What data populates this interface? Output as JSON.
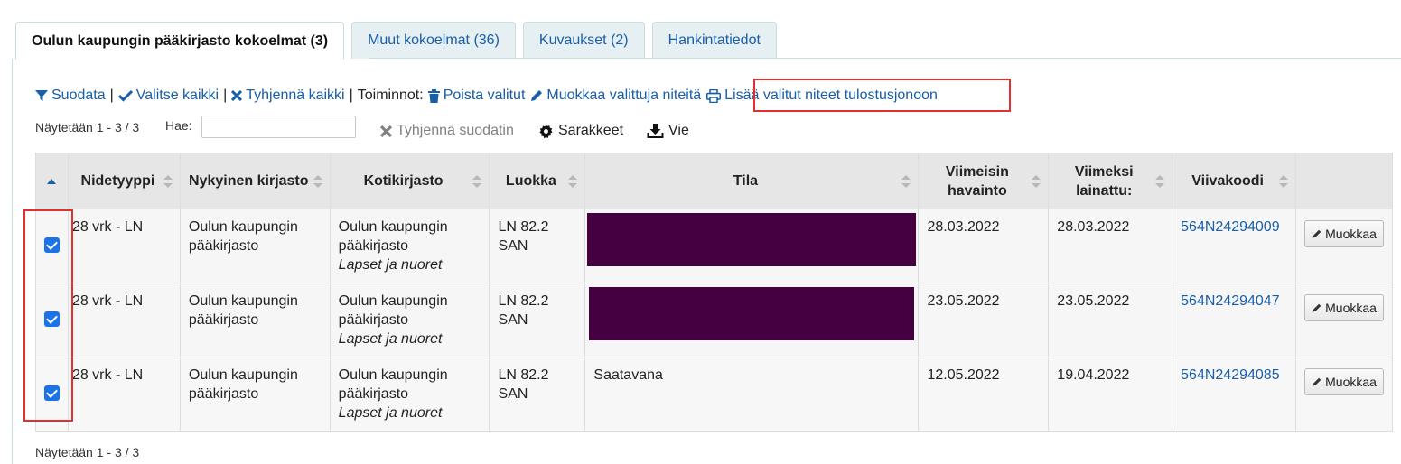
{
  "tabs": [
    {
      "label": "Oulun kaupungin pääkirjasto kokoelmat (3)",
      "active": true
    },
    {
      "label": "Muut kokoelmat (36)"
    },
    {
      "label": "Kuvaukset (2)"
    },
    {
      "label": "Hankintatiedot"
    }
  ],
  "toolbar": {
    "filter": "Suodata",
    "select_all": "Valitse kaikki",
    "clear_all": "Tyhjennä kaikki",
    "separator": "|",
    "actions_label": "Toiminnot:",
    "delete_selected": "Poista valitut",
    "edit_selected": "Muokkaa valittuja niteitä",
    "add_to_print_queue": "Lisää valitut niteet tulostusjonoon"
  },
  "info": {
    "showing": "Näytetään 1 - 3 / 3",
    "search_label": "Hae:",
    "search_value": "",
    "clear_filter": "Tyhjennä suodatin",
    "columns": "Sarakkeet",
    "export": "Vie"
  },
  "table": {
    "headers": {
      "item_type": "Nidetyyppi",
      "current_library": "Nykyinen kirjasto",
      "home_library": "Kotikirjasto",
      "call_number": "Luokka",
      "status": "Tila",
      "last_seen": "Viimeisin havainto",
      "last_borrowed": "Viimeksi lainattu:",
      "barcode": "Viivakoodi"
    },
    "rows": [
      {
        "checked": true,
        "item_type": "28 vrk - LN",
        "current_library": "Oulun kaupungin pääkirjasto",
        "home_library": "Oulun kaupungin pääkirjasto",
        "location": "Lapset ja nuoret",
        "call_number": "LN 82.2 SAN",
        "status": "",
        "last_seen": "28.03.2022",
        "last_borrowed": "28.03.2022",
        "barcode": "564N24294009",
        "edit": "Muokkaa"
      },
      {
        "checked": true,
        "item_type": "28 vrk - LN",
        "current_library": "Oulun kaupungin pääkirjasto",
        "home_library": "Oulun kaupungin pääkirjasto",
        "location": "Lapset ja nuoret",
        "call_number": "LN 82.2 SAN",
        "status": "",
        "last_seen": "23.05.2022",
        "last_borrowed": "23.05.2022",
        "barcode": "564N24294047",
        "edit": "Muokkaa"
      },
      {
        "checked": true,
        "item_type": "28 vrk - LN",
        "current_library": "Oulun kaupungin pääkirjasto",
        "home_library": "Oulun kaupungin pääkirjasto",
        "location": "Lapset ja nuoret",
        "call_number": "LN 82.2 SAN",
        "status": "Saatavana",
        "last_seen": "12.05.2022",
        "last_borrowed": "19.04.2022",
        "barcode": "564N24294085",
        "edit": "Muokkaa"
      }
    ]
  },
  "footer": {
    "showing": "Näytetään 1 - 3 / 3"
  },
  "colors": {
    "link": "#185ea8",
    "redacted": "#440040",
    "highlight": "#e03030",
    "checkbox": "#1a73e8"
  }
}
